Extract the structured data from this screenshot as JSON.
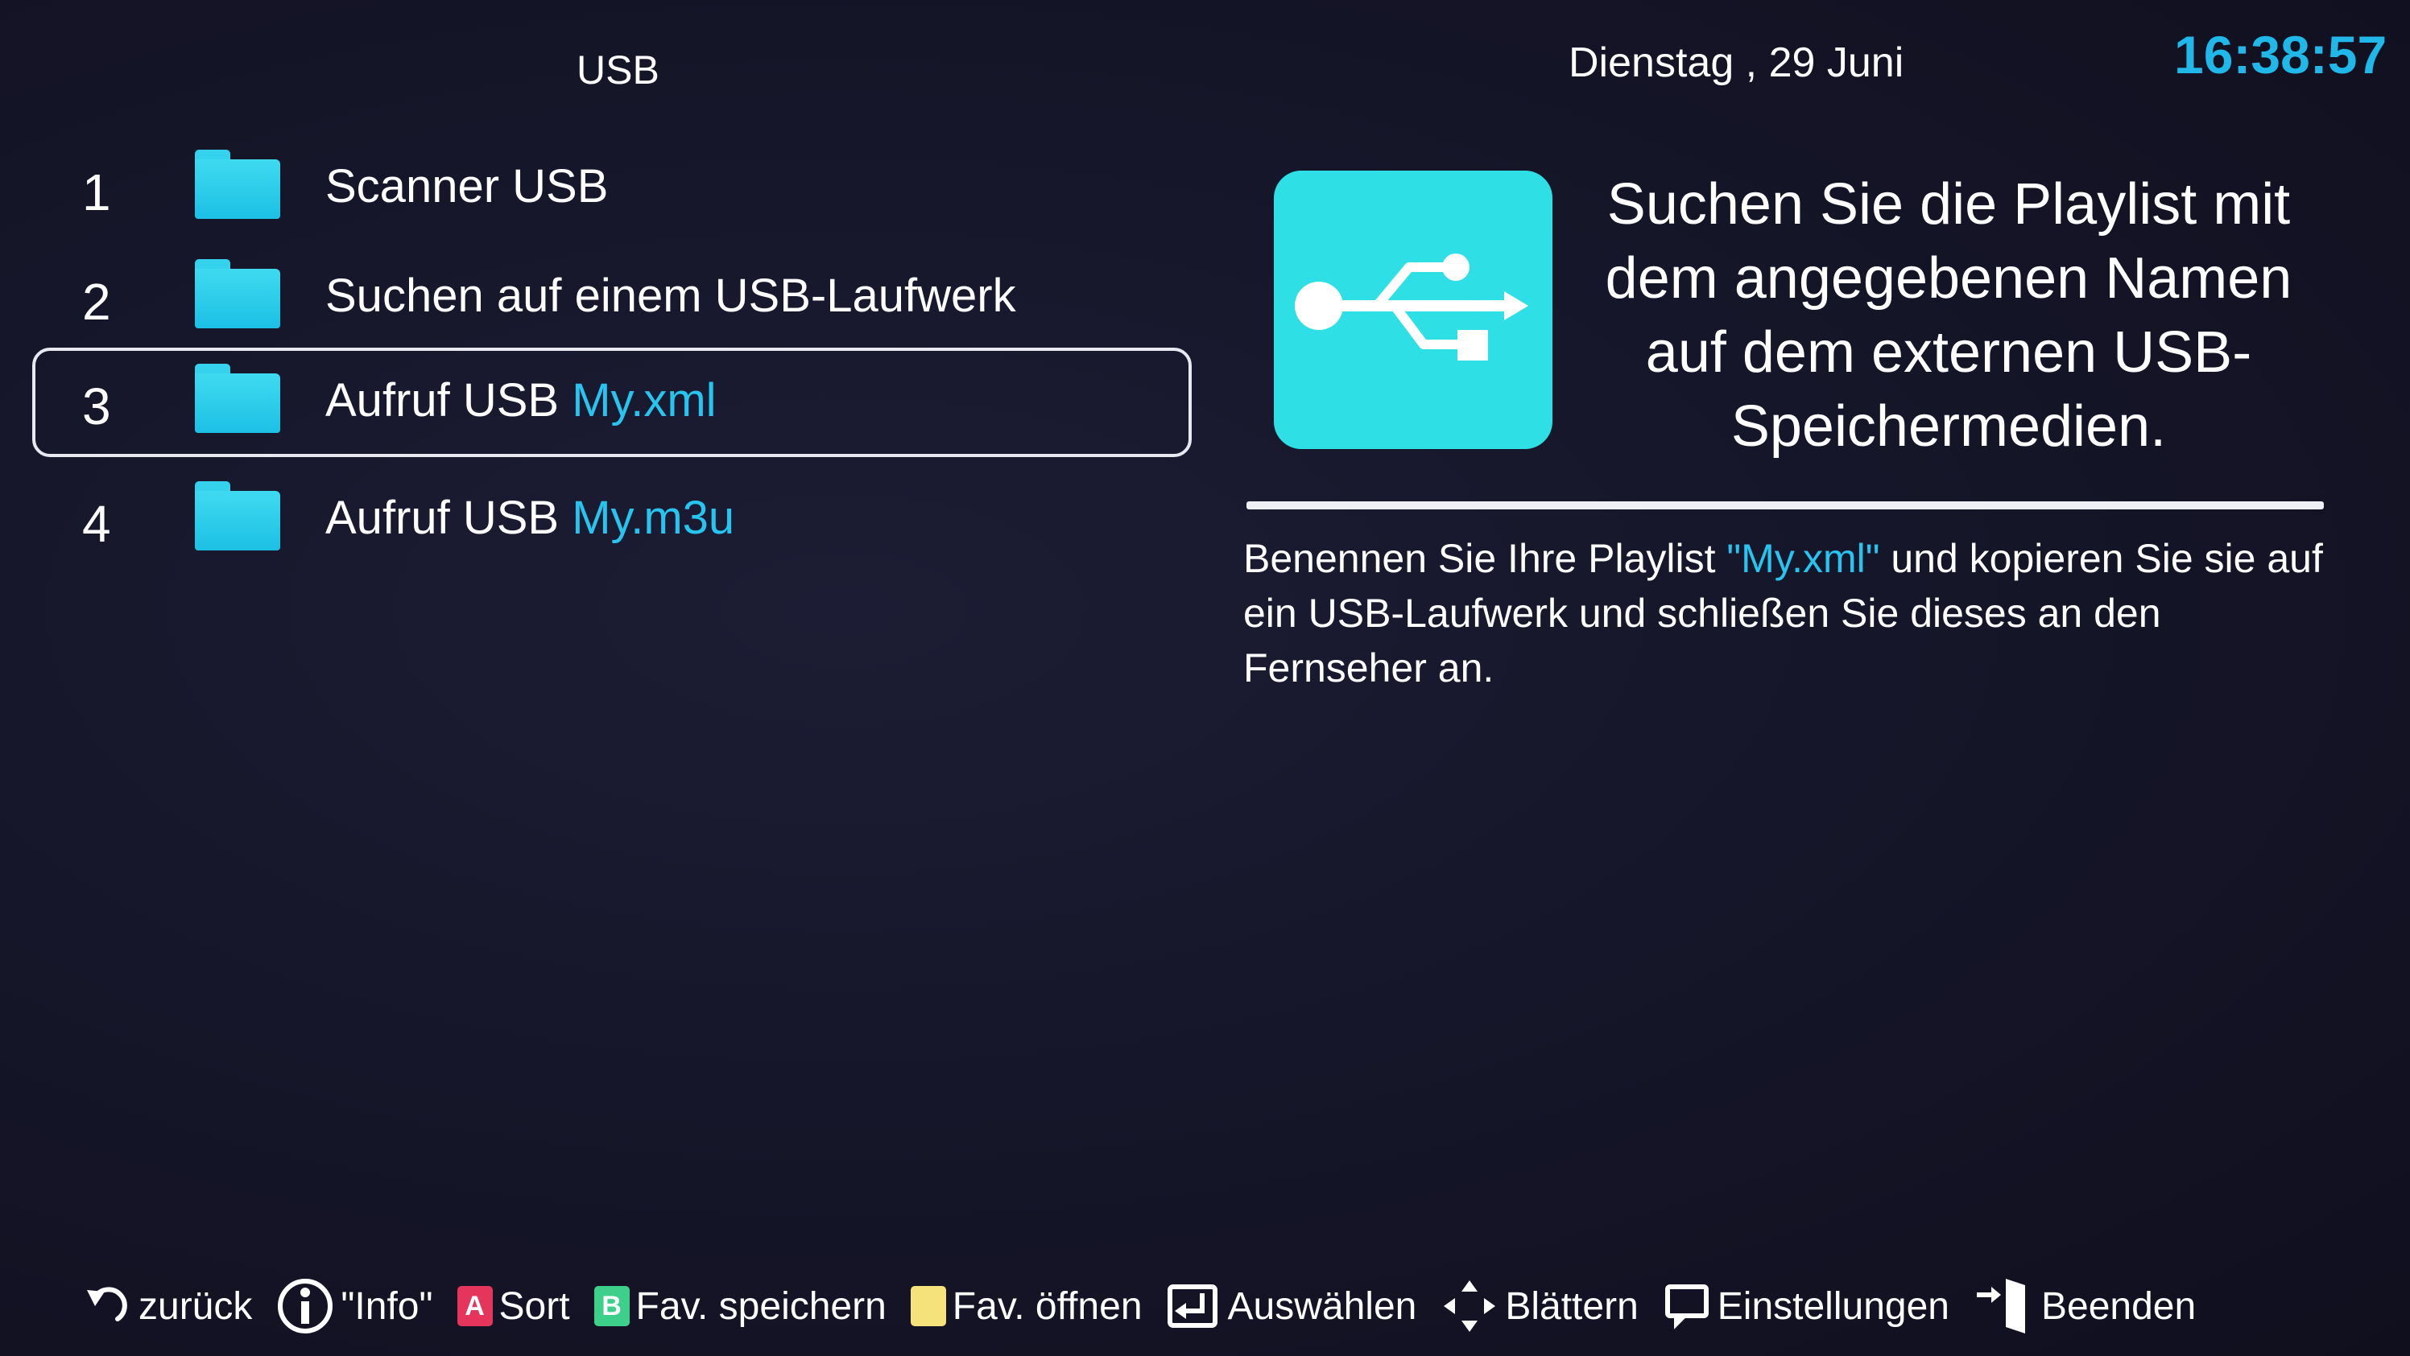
{
  "header": {
    "title": "USB",
    "date": "Dienstag , 29 Juni",
    "time": "16:38:57"
  },
  "menu": {
    "items": [
      {
        "number": "1",
        "label": "Scanner USB",
        "highlight": ""
      },
      {
        "number": "2",
        "label": "Suchen auf einem USB-Laufwerk",
        "highlight": ""
      },
      {
        "number": "3",
        "label": "Aufruf USB ",
        "highlight": "My.xml"
      },
      {
        "number": "4",
        "label": "Aufruf USB ",
        "highlight": "My.m3u"
      }
    ],
    "selected_index": 2
  },
  "info": {
    "icon": "usb-icon",
    "title": "Suchen Sie die Playlist mit dem angegebenen Namen auf dem externen USB-Speichermedien.",
    "body_before": "Benennen Sie Ihre Playlist ",
    "body_highlight": "\"My.xml\"",
    "body_after": " und kopieren Sie sie auf ein USB-Laufwerk und schließen Sie dieses an den Fernseher an."
  },
  "footer": {
    "back": "zurück",
    "info": "\"Info\"",
    "red_key": "A",
    "red_label": "Sort",
    "green_key": "B",
    "green_label": "Fav. speichern",
    "yellow_label": "Fav. öffnen",
    "select": "Auswählen",
    "scroll": "Blättern",
    "settings": "Einstellungen",
    "exit": "Beenden"
  },
  "colors": {
    "accent": "#26c4ef",
    "folder": "#2fcdee",
    "usb_tile": "#2ee0e6",
    "red": "#e5355d",
    "green": "#3cd08a",
    "yellow": "#f6e27a"
  }
}
